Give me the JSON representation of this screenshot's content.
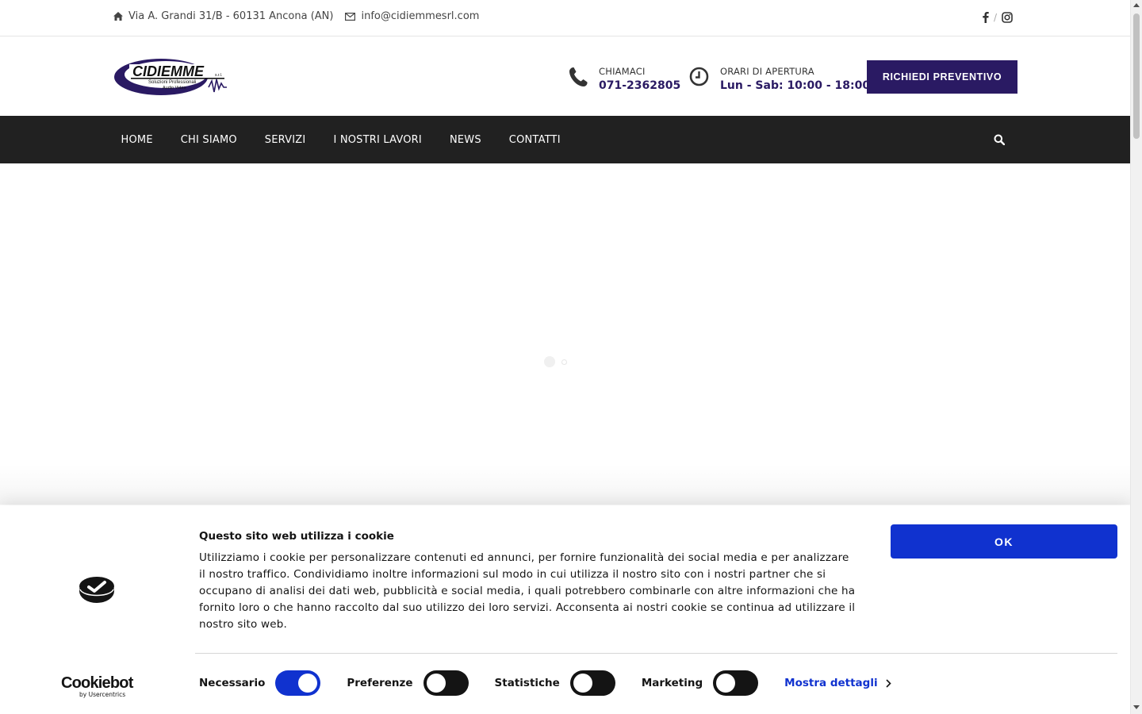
{
  "topbar": {
    "address": "Via A. Grandi 31/B - 60131 Ancona (AN)",
    "email": "info@cidiemmesrl.com",
    "social_separator": "/"
  },
  "logo": {
    "brand": "CIDIEMME",
    "suffix": "s.r.l.",
    "tagline1": "Soluzioni Professionali",
    "tagline2": "Audio Video"
  },
  "header": {
    "phone_label": "CHIAMACI",
    "phone_value": "071-2362805",
    "hours_label": "ORARI DI APERTURA",
    "hours_value": "Lun - Sab: 10:00 - 18:00",
    "cta_label": "RICHIEDI PREVENTIVO"
  },
  "nav": {
    "items": [
      "HOME",
      "CHI SIAMO",
      "SERVIZI",
      "I NOSTRI LAVORI",
      "NEWS",
      "CONTATTI"
    ]
  },
  "cookie": {
    "title": "Questo sito web utilizza i cookie",
    "body": "Utilizziamo i cookie per personalizzare contenuti ed annunci, per fornire funzionalità dei social media e per analizzare il nostro traffico. Condividiamo inoltre informazioni sul modo in cui utilizza il nostro sito con i nostri partner che si occupano di analisi dei dati web, pubblicità e social media, i quali potrebbero combinarle con altre informazioni che ha fornito loro o che hanno raccolto dal suo utilizzo dei loro servizi. Acconsenta ai nostri cookie se continua ad utilizzare il nostro sito web.",
    "ok_label": "OK",
    "toggles": [
      {
        "label": "Necessario",
        "on": true
      },
      {
        "label": "Preferenze",
        "on": false
      },
      {
        "label": "Statistiche",
        "on": false
      },
      {
        "label": "Marketing",
        "on": false
      }
    ],
    "details_label": "Mostra dettagli",
    "brand_name": "Cookiebot",
    "brand_by": "by Usercentrics"
  },
  "colors": {
    "brand": "#2a1a63",
    "nav_bg": "#212121",
    "cookie_accent": "#1032cf"
  }
}
